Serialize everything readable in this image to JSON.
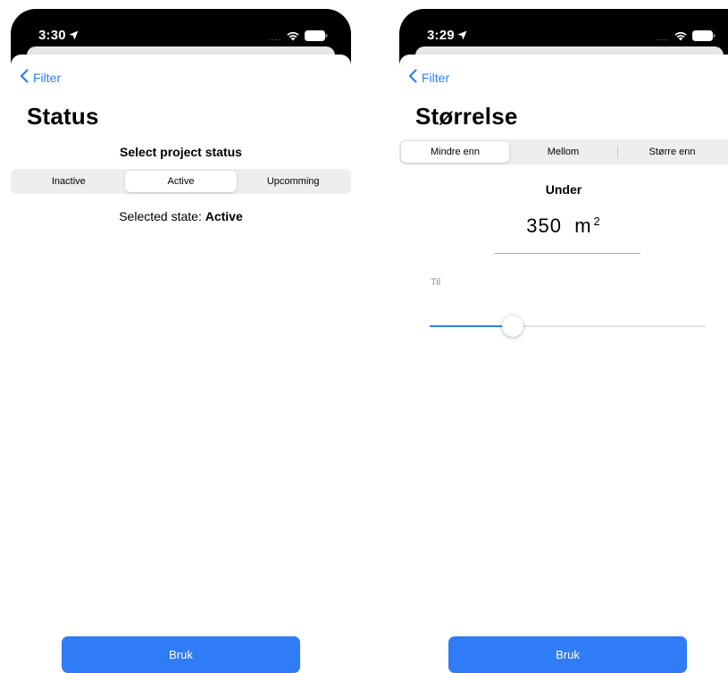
{
  "status_screen": {
    "status_bar": {
      "time": "3:30"
    },
    "back_label": "Filter",
    "title": "Status",
    "section_heading": "Select project status",
    "segments": [
      {
        "label": "Inactive",
        "selected": false
      },
      {
        "label": "Active",
        "selected": true
      },
      {
        "label": "Upcomming",
        "selected": false
      }
    ],
    "selected_state_prefix": "Selected state:",
    "selected_state_value": "Active",
    "apply_label": "Bruk"
  },
  "size_screen": {
    "status_bar": {
      "time": "3:29"
    },
    "back_label": "Filter",
    "title": "Størrelse",
    "segments": [
      {
        "label": "Mindre enn",
        "selected": true
      },
      {
        "label": "Mellom",
        "selected": false
      },
      {
        "label": "Større enn",
        "selected": false
      }
    ],
    "mode_label": "Under",
    "value": "350",
    "unit": "m",
    "unit_superscript": "2",
    "til_label": "Til",
    "slider_fraction": 0.3,
    "apply_label": "Bruk"
  },
  "colors": {
    "accent": "#2f7cf6",
    "status_bar": "#000000",
    "segment_bg": "#eeeef0"
  }
}
